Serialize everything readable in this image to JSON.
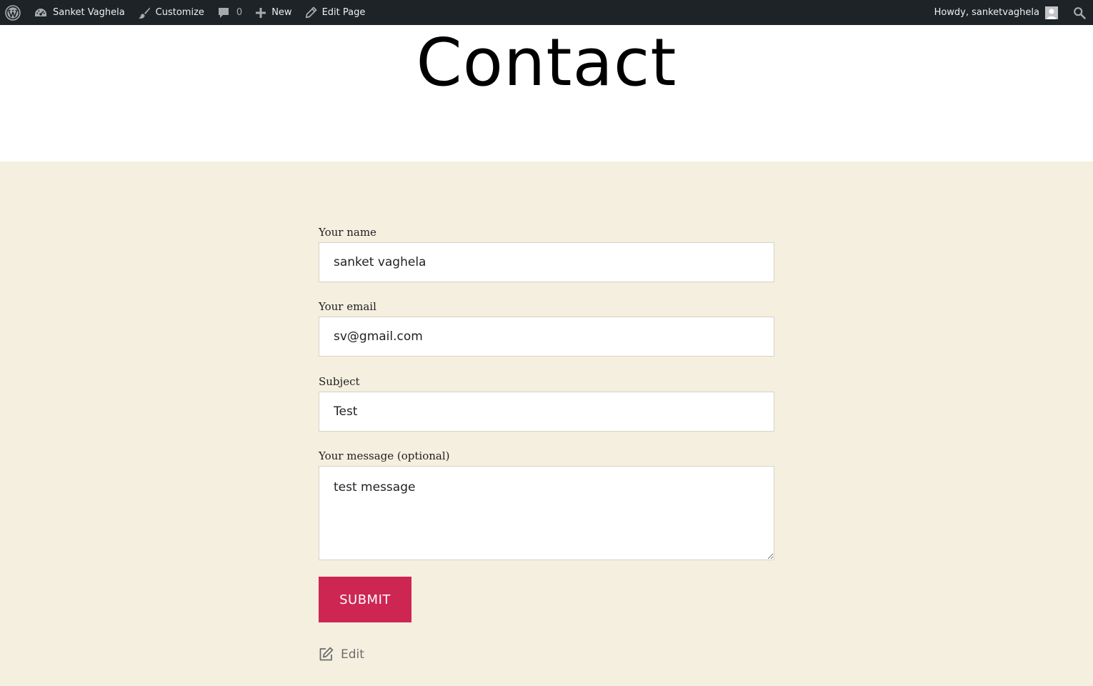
{
  "admin_bar": {
    "site_name": "Sanket Vaghela",
    "customize_label": "Customize",
    "comments_count": "0",
    "new_label": "New",
    "edit_page_label": "Edit Page",
    "greeting": "Howdy, sanketvaghela"
  },
  "page": {
    "title": "Contact"
  },
  "form": {
    "name_label": "Your name",
    "name_value": "sanket vaghela",
    "email_label": "Your email",
    "email_value": "sv@gmail.com",
    "subject_label": "Subject",
    "subject_value": "Test",
    "message_label": "Your message (optional)",
    "message_value": "test message",
    "submit_label": "SUBMIT"
  },
  "edit_link": {
    "label": "Edit"
  },
  "colors": {
    "admin_bar_bg": "#1d2327",
    "page_bg": "#f5efe0",
    "accent": "#cd2653"
  },
  "icons": [
    "wordpress-icon",
    "dashboard-icon",
    "brush-icon",
    "comment-icon",
    "plus-icon",
    "pencil-icon",
    "avatar-icon",
    "search-icon",
    "edit-icon"
  ]
}
